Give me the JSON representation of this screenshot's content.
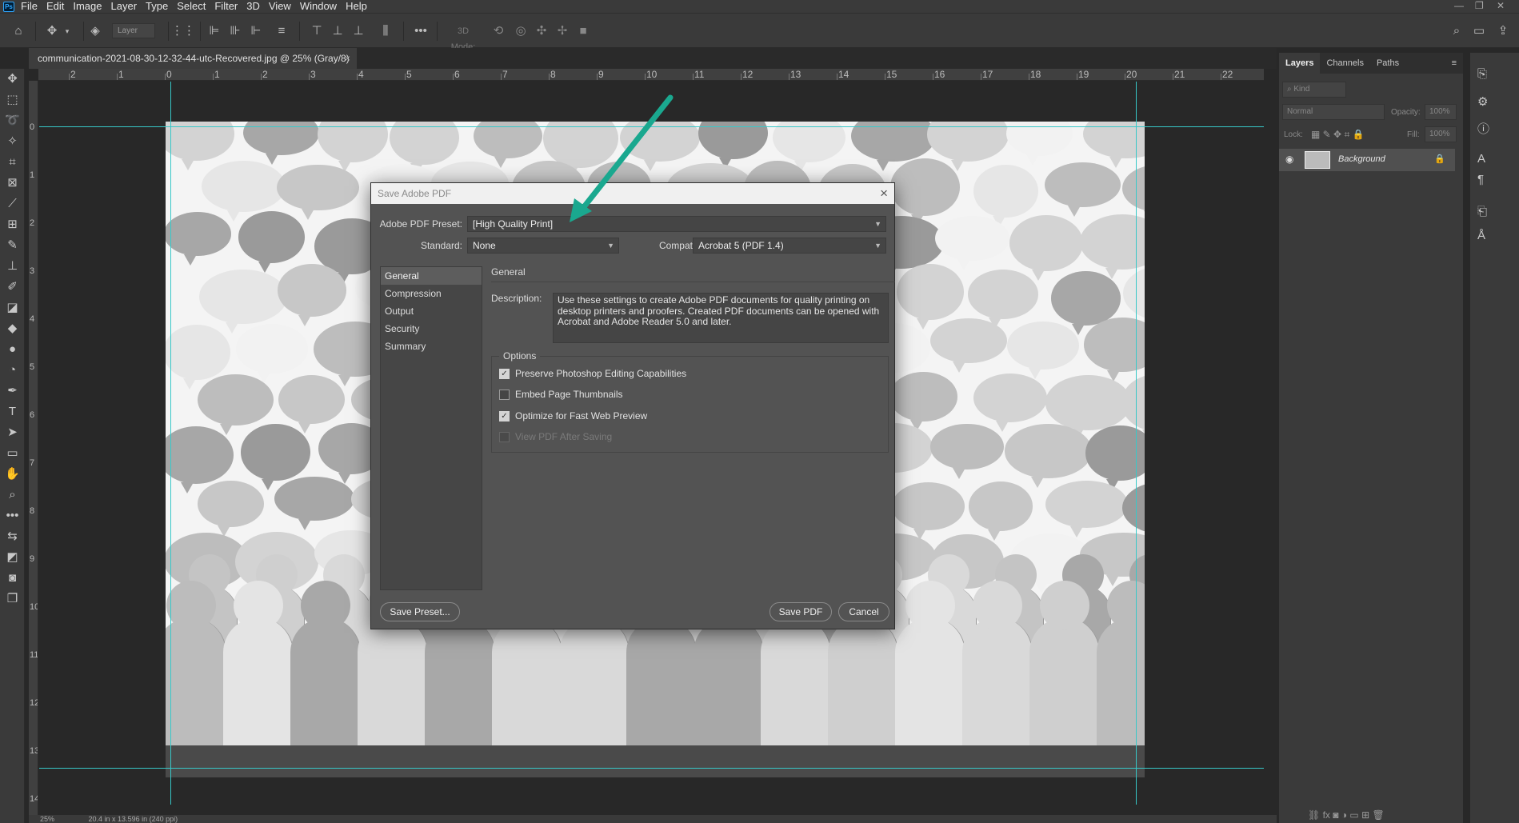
{
  "menubar": {
    "logo": "Ps",
    "items": [
      "File",
      "Edit",
      "Image",
      "Layer",
      "Type",
      "Select",
      "Filter",
      "3D",
      "View",
      "Window",
      "Help"
    ]
  },
  "options_bar": {
    "layer_select": "Layer",
    "mode_3d_label": "3D Mode:"
  },
  "document": {
    "tab_title": "communication-2021-08-30-12-32-44-utc-Recovered.jpg @ 25% (Gray/8)",
    "close_glyph": "×"
  },
  "rulers": {
    "top_labels": [
      "2",
      "1",
      "0",
      "1",
      "2",
      "3",
      "4",
      "5",
      "6",
      "7",
      "8",
      "9",
      "10",
      "11",
      "12",
      "13",
      "14",
      "15",
      "16",
      "17",
      "18",
      "19",
      "20",
      "21",
      "22"
    ],
    "left_labels": [
      "0",
      "1",
      "2",
      "3",
      "4",
      "5",
      "6",
      "7",
      "8",
      "9",
      "10",
      "11",
      "12",
      "13",
      "14"
    ]
  },
  "status": {
    "zoom": "25%",
    "doc_info": "20.4 in x 13.596 in (240 ppi)"
  },
  "layers_panel": {
    "tabs": [
      "Layers",
      "Channels",
      "Paths"
    ],
    "kind_placeholder": "Kind",
    "blend_mode": "Normal",
    "opacity_label": "Opacity:",
    "opacity_value": "100%",
    "lock_label": "Lock:",
    "fill_label": "Fill:",
    "fill_value": "100%",
    "layer_name": "Background"
  },
  "dialog": {
    "title": "Save Adobe PDF",
    "preset_label": "Adobe PDF Preset:",
    "preset_value": "[High Quality Print]",
    "standard_label": "Standard:",
    "standard_value": "None",
    "compat_label": "Compatibility:",
    "compat_value": "Acrobat 5 (PDF 1.4)",
    "nav": [
      "General",
      "Compression",
      "Output",
      "Security",
      "Summary"
    ],
    "section_title": "General",
    "desc_label": "Description:",
    "description": "Use these settings to create Adobe PDF documents for quality printing on desktop printers and proofers.  Created PDF documents can be opened with Acrobat and Adobe Reader 5.0 and later.",
    "options_label": "Options",
    "options": [
      {
        "label": "Preserve Photoshop Editing Capabilities",
        "checked": true,
        "enabled": true
      },
      {
        "label": "Embed Page Thumbnails",
        "checked": false,
        "enabled": true
      },
      {
        "label": "Optimize for Fast Web Preview",
        "checked": true,
        "enabled": true
      },
      {
        "label": "View PDF After Saving",
        "checked": false,
        "enabled": false
      }
    ],
    "save_preset_label": "Save Preset...",
    "save_pdf_label": "Save PDF",
    "cancel_label": "Cancel"
  },
  "colors": {
    "guide": "#37c8c8",
    "annotation_arrow": "#1aa88f",
    "ps_blue": "#31a8ff"
  }
}
